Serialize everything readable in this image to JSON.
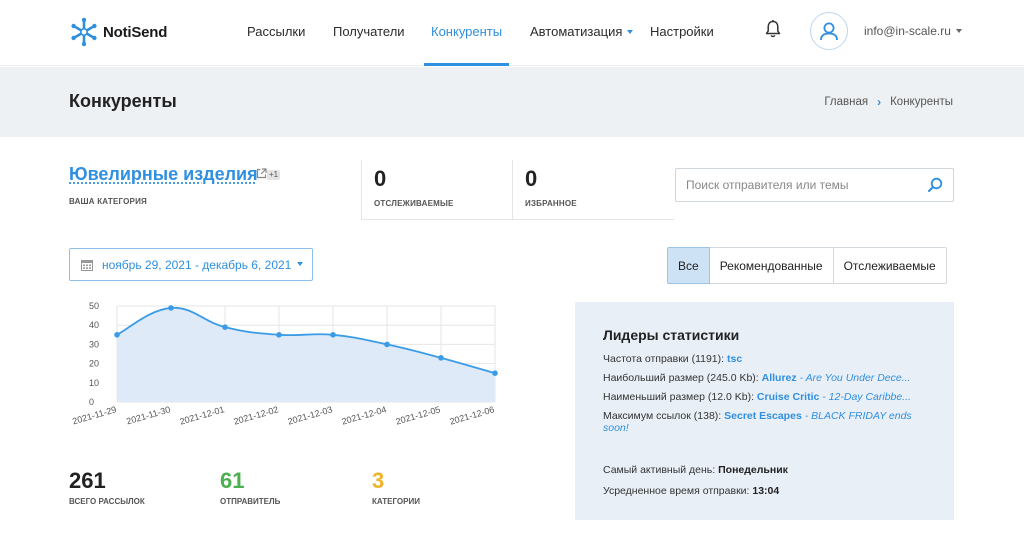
{
  "header": {
    "logo_text": "NotiSend",
    "nav": [
      {
        "label": "Рассылки"
      },
      {
        "label": "Получатели"
      },
      {
        "label": "Конкуренты"
      },
      {
        "label": "Автоматизация"
      },
      {
        "label": "Настройки"
      }
    ],
    "user_email": "info@in-scale.ru"
  },
  "page": {
    "title": "Конкуренты",
    "breadcrumb": [
      "Главная",
      "Конкуренты"
    ]
  },
  "stats": {
    "category_name": "Ювелирные изделия",
    "category_badge": "+1",
    "category_label": "ВАША КАТЕГОРИЯ",
    "tracked_value": "0",
    "tracked_label": "ОТСЛЕЖИВАЕМЫЕ",
    "favorites_value": "0",
    "favorites_label": "ИЗБРАННОЕ"
  },
  "search": {
    "placeholder": "Поиск отправителя или темы"
  },
  "date_range": "ноябрь 29, 2021 - декабрь 6, 2021",
  "filters": [
    "Все",
    "Рекомендованные",
    "Отслеживаемые"
  ],
  "active_filter": "Все",
  "chart_data": {
    "type": "area",
    "x": [
      "2021-11-29",
      "2021-11-30",
      "2021-12-01",
      "2021-12-02",
      "2021-12-03",
      "2021-12-04",
      "2021-12-05",
      "2021-12-06"
    ],
    "values": [
      35,
      49,
      39,
      35,
      35,
      30,
      23,
      15
    ],
    "ylim": [
      0,
      50
    ],
    "yticks": [
      "0",
      "10",
      "20",
      "30",
      "40",
      "50"
    ],
    "grid": true,
    "color": "#3a9ce6",
    "fill": "#deeaf8"
  },
  "totals": {
    "mailings_value": "261",
    "mailings_label": "ВСЕГО РАССЫЛОК",
    "senders_value": "61",
    "senders_label": "ОТПРАВИТЕЛЬ",
    "categories_value": "3",
    "categories_label": "КАТЕГОРИИ",
    "colors": {
      "mailings": "#222222",
      "senders": "#4caf50",
      "categories": "#f0b429"
    }
  },
  "leaders": {
    "title": "Лидеры статистики",
    "frequency_label": "Частота отправки (1191):",
    "frequency_link": "tsc",
    "largest_label": "Наибольший размер (245.0 Kb):",
    "largest_sender": "Allurez",
    "largest_subject": "- Are You Under Dece...",
    "smallest_label": "Наименьший размер (12.0 Kb):",
    "smallest_sender": "Cruise Critic",
    "smallest_subject": "- 12-Day Caribbe...",
    "links_label": "Максимум ссылок (138):",
    "links_sender": "Secret Escapes",
    "links_subject": "- BLACK FRIDAY ends soon!",
    "active_day_label": "Самый активный день:",
    "active_day_value": "Понедельник",
    "avg_time_label": "Усредненное время отправки:",
    "avg_time_value": "13:04"
  },
  "icons": [
    "logo-snowflake-icon",
    "bell-icon",
    "user-icon",
    "external-link-icon",
    "search-icon",
    "calendar-icon",
    "caret-down-icon",
    "breadcrumb-chevron-icon"
  ]
}
